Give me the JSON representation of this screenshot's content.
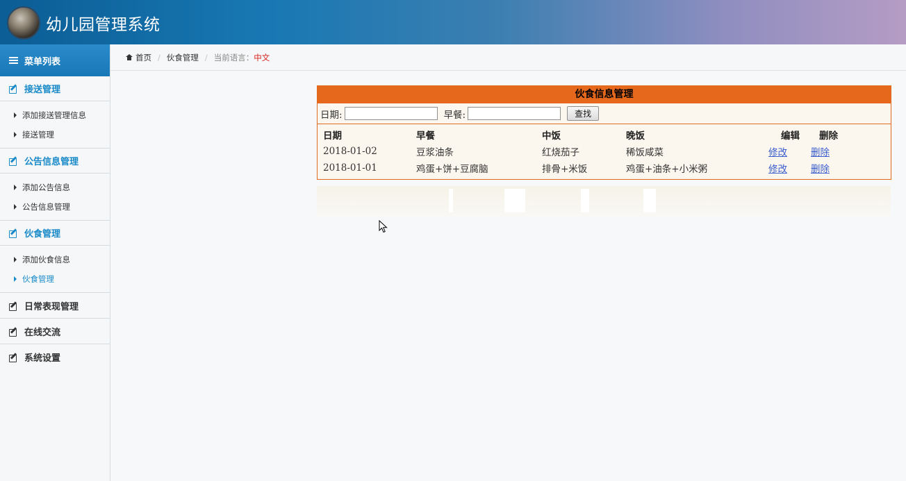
{
  "header": {
    "title": "幼儿园管理系统"
  },
  "sidebar": {
    "menu_title": "菜单列表",
    "groups": [
      {
        "title": "接送管理",
        "items": [
          "添加接送管理信息",
          "接送管理"
        ]
      },
      {
        "title": "公告信息管理",
        "items": [
          "添加公告信息",
          "公告信息管理"
        ]
      },
      {
        "title": "伙食管理",
        "items": [
          "添加伙食信息",
          "伙食管理"
        ]
      }
    ],
    "collapsed": [
      "日常表现管理",
      "在线交流",
      "系统设置"
    ]
  },
  "breadcrumb": {
    "home": "首页",
    "current": "伙食管理",
    "lang_label": "当前语言：",
    "lang_value": "中文"
  },
  "panel": {
    "title": "伙食信息管理",
    "search": {
      "date_label": "日期:",
      "breakfast_label": "早餐:",
      "date_value": "",
      "breakfast_value": "",
      "button": "查找"
    },
    "columns": [
      "日期",
      "早餐",
      "中饭",
      "晚饭",
      "编辑",
      "删除"
    ],
    "rows": [
      {
        "date": "2018-01-02",
        "breakfast": "豆浆油条",
        "lunch": "红烧茄子",
        "dinner": "稀饭咸菜",
        "edit": "修改",
        "delete": "删除"
      },
      {
        "date": "2018-01-01",
        "breakfast": "鸡蛋+饼+豆腐脑",
        "lunch": "排骨+米饭",
        "dinner": "鸡蛋+油条+小米粥",
        "edit": "修改",
        "delete": "删除"
      }
    ]
  },
  "colors": {
    "header_start": "#0b5d95",
    "menu_head": "#1a7fc0",
    "accent_blue": "#1a8ac9",
    "panel_orange": "#e5681c",
    "lang_red": "#d9231e",
    "link": "#3a5fcd"
  }
}
